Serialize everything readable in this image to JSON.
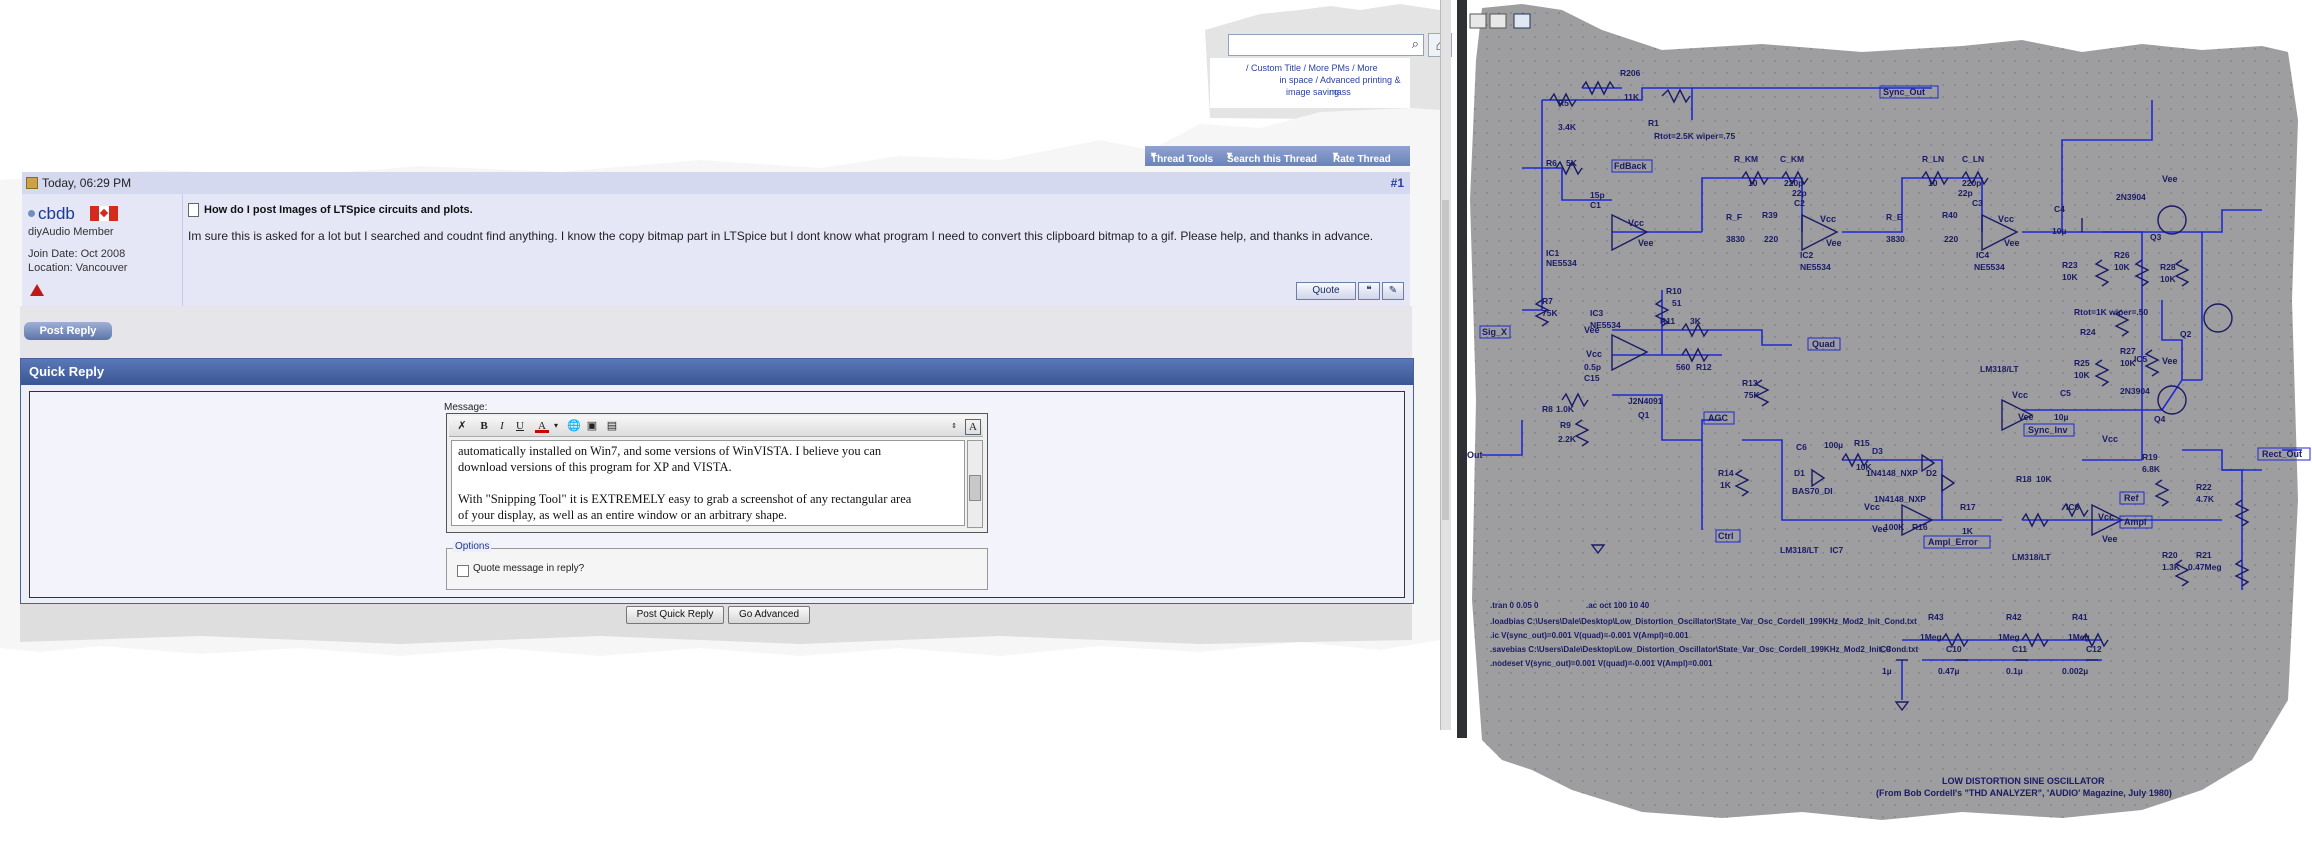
{
  "forum": {
    "top_links": [
      "/ Custom Title",
      "/ More PMs",
      "/ More",
      "in space",
      "/ Advanced printing & mass",
      "image saving"
    ],
    "thread_tools": [
      "Thread Tools",
      "Search this Thread",
      "Rate Thread"
    ],
    "post": {
      "date": "Today, 06:29 PM",
      "number": "#1",
      "username": "cbdb",
      "role": "diyAudio Member",
      "join_date": "Join Date: Oct 2008",
      "location": "Location: Vancouver",
      "title": "How do I post Images of LTSpice circuits and plots.",
      "text": "Im sure this is asked for a lot but I searched and coudnt find anything. I know the copy bitmap part in LTSpice but I dont know what program I need to convert this clipboard bitmap to a gif. Please help, and thanks in advance.",
      "quote_label": "Quote"
    },
    "post_reply_label": "Post Reply",
    "quick_reply": {
      "title": "Quick Reply",
      "message_label": "Message:",
      "editor_text": [
        "automatically installed on Win7, and some versions of WinVISTA. I believe you can",
        "download versions of this program for XP and VISTA.",
        "",
        "With \"Snipping Tool\" it is EXTREMELY easy to grab a screenshot of any rectangular area",
        "of your display, as well as an entire window or an arbitrary shape."
      ],
      "options_label": "Options",
      "quote_checkbox_label": "Quote message in reply?",
      "post_button": "Post Quick Reply",
      "advanced_button": "Go Advanced"
    }
  },
  "ltspice": {
    "labels": {
      "sync_out": "Sync_Out",
      "fdback": "FdBack",
      "sig_x": "Sig_X",
      "quad": "Quad",
      "agc": "AGC",
      "rect_out": "Rect_Out",
      "sync_inv": "Sync_Inv",
      "ref": "Ref",
      "ampl": "Ampl",
      "ampl_error": "Ampl_Error",
      "ctrl": "Ctrl",
      "out_left": "_Out",
      "vee": "Vee",
      "vcc": "Vcc"
    },
    "components": [
      {
        "name": "R206",
        "value": "11K"
      },
      {
        "name": "R5",
        "value": "3.4K"
      },
      {
        "name": "R1",
        "value": "Rtot=2.5K wiper=.75"
      },
      {
        "name": "R6",
        "value": "5K"
      },
      {
        "name": "C1",
        "value": "15p"
      },
      {
        "name": "R_F",
        "value": "3830"
      },
      {
        "name": "R_KM",
        "value": "10"
      },
      {
        "name": "C_KM",
        "value": "220p"
      },
      {
        "name": "R39",
        "value": "220"
      },
      {
        "name": "C2",
        "value": "22p"
      },
      {
        "name": "R_E",
        "value": "3830"
      },
      {
        "name": "R_LN",
        "value": "10"
      },
      {
        "name": "C_LN",
        "value": "220p"
      },
      {
        "name": "R40",
        "value": "220"
      },
      {
        "name": "C3",
        "value": "22p"
      },
      {
        "name": "C4",
        "value": "10µ"
      },
      {
        "name": "Q3",
        "value": "2N3904"
      },
      {
        "name": "IC1",
        "value": "NE5534"
      },
      {
        "name": "IC2",
        "value": "NE5534"
      },
      {
        "name": "IC4",
        "value": "NE5534"
      },
      {
        "name": "R23",
        "value": "10K"
      },
      {
        "name": "R26",
        "value": "10K"
      },
      {
        "name": "R28",
        "value": "10K"
      },
      {
        "name": "R7",
        "value": "75K"
      },
      {
        "name": "R10",
        "value": "51"
      },
      {
        "name": "IC3",
        "value": "NE5534"
      },
      {
        "name": "R11",
        "value": "3K"
      },
      {
        "name": "R12",
        "value": "560"
      },
      {
        "name": "C15",
        "value": "0.5p"
      },
      {
        "name": "R24",
        "value": "Rtot=1K wiper=.50"
      },
      {
        "name": "Q2",
        "value": "2N3904"
      },
      {
        "name": "R25",
        "value": "10K"
      },
      {
        "name": "R27",
        "value": "10K"
      },
      {
        "name": "IC5",
        "value": "LM318/LT"
      },
      {
        "name": "C5",
        "value": "10µ"
      },
      {
        "name": "Q4",
        "value": "2N3904"
      },
      {
        "name": "R13",
        "value": "75K"
      },
      {
        "name": "Q1",
        "value": "J2N4091"
      },
      {
        "name": "R8",
        "value": "1.0K"
      },
      {
        "name": "R9",
        "value": "2.2K"
      },
      {
        "name": "R14",
        "value": "1K"
      },
      {
        "name": "C6",
        "value": "100µ"
      },
      {
        "name": "R15",
        "value": "10K"
      },
      {
        "name": "D1",
        "value": "BAS70_DI"
      },
      {
        "name": "D3",
        "value": "1N4148_NXP"
      },
      {
        "name": "D2",
        "value": "1N4148_NXP"
      },
      {
        "name": "R16",
        "value": "100K"
      },
      {
        "name": "R17",
        "value": "1K"
      },
      {
        "name": "R18",
        "value": "10K"
      },
      {
        "name": "IC6",
        "value": "LM318/LT"
      },
      {
        "name": "IC7",
        "value": "LM318/LT"
      },
      {
        "name": "R19",
        "value": "6.8K"
      },
      {
        "name": "R22",
        "value": "4.7K"
      },
      {
        "name": "R20",
        "value": "1.3K"
      },
      {
        "name": "R21",
        "value": "0.47Meg"
      },
      {
        "name": "R43",
        "value": "1Meg"
      },
      {
        "name": "R42",
        "value": "1Meg"
      },
      {
        "name": "R41",
        "value": "1Meg"
      },
      {
        "name": "C10",
        "value": "0.47µ"
      },
      {
        "name": "C11",
        "value": "0.1µ"
      },
      {
        "name": "C12",
        "value": "0.002µ"
      },
      {
        "name": "C9",
        "value": "1µ"
      }
    ],
    "directives": [
      ".tran 0 0.05 0",
      ".ac oct 100 10 40",
      ".loadbias C:\\Users\\Dale\\Desktop\\Low_Distortion_Oscillator\\State_Var_Osc_Cordell_199KHz_Mod2_Init_Cond.txt",
      ".ic V(sync_out)=0.001 V(quad)=-0.001 V(Ampl)=0.001",
      ".savebias C:\\Users\\Dale\\Desktop\\Low_Distortion_Oscillator\\State_Var_Osc_Cordell_199KHz_Mod2_Init_Cond.txt",
      ".nodeset V(sync_out)=0.001 V(quad)=-0.001 V(Ampl)=0.001"
    ],
    "title_line1": "LOW DISTORTION SINE OSCILLATOR",
    "title_line2": "(From Bob Cordell's \"THD ANALYZER\", 'AUDIO' Magazine, July 1980)"
  },
  "colors": {
    "schematic_bg": "#9e9ea0",
    "wire": "#1f2ad1",
    "forum_header": "#3a5593",
    "post_bg": "#e5e7f7"
  }
}
